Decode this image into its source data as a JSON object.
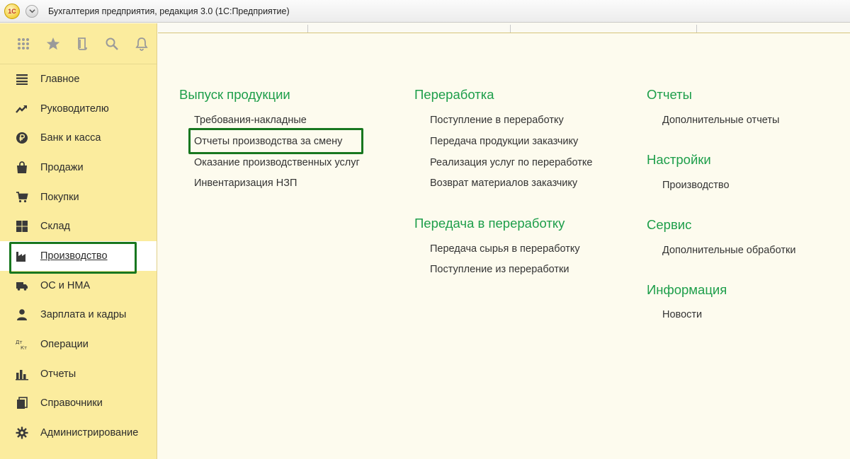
{
  "window": {
    "title": "Бухгалтерия предприятия, редакция 3.0  (1С:Предприятие)",
    "logo_text": "1С"
  },
  "toolbar": {
    "icons": [
      "apps-grid-icon",
      "star-icon",
      "history-icon",
      "search-icon",
      "bell-icon"
    ]
  },
  "sidebar": {
    "active": "Производство",
    "items": [
      {
        "label": "Главное",
        "icon": "menu-lines-icon"
      },
      {
        "label": "Руководителю",
        "icon": "trend-up-icon"
      },
      {
        "label": "Банк и касса",
        "icon": "ruble-coin-icon"
      },
      {
        "label": "Продажи",
        "icon": "shopping-bag-icon"
      },
      {
        "label": "Покупки",
        "icon": "cart-icon"
      },
      {
        "label": "Склад",
        "icon": "warehouse-grid-icon"
      },
      {
        "label": "Производство",
        "icon": "factory-icon"
      },
      {
        "label": "ОС и НМА",
        "icon": "truck-icon"
      },
      {
        "label": "Зарплата и кадры",
        "icon": "person-icon"
      },
      {
        "label": "Операции",
        "icon": "dt-kt-icon"
      },
      {
        "label": "Отчеты",
        "icon": "bar-chart-icon"
      },
      {
        "label": "Справочники",
        "icon": "books-icon"
      },
      {
        "label": "Администрирование",
        "icon": "gear-icon"
      }
    ]
  },
  "sections": {
    "output": {
      "title": "Выпуск продукции",
      "links": [
        "Требования-накладные",
        "Отчеты производства за смену",
        "Оказание производственных услуг",
        "Инвентаризация НЗП"
      ]
    },
    "processing": {
      "title": "Переработка",
      "links": [
        "Поступление в переработку",
        "Передача продукции заказчику",
        "Реализация услуг по переработке",
        "Возврат материалов заказчику"
      ]
    },
    "to_processing": {
      "title": "Передача в переработку",
      "links": [
        "Передача сырья в переработку",
        "Поступление из переработки"
      ]
    },
    "reports": {
      "title": "Отчеты",
      "links": [
        "Дополнительные отчеты"
      ]
    },
    "settings": {
      "title": "Настройки",
      "links": [
        "Производство"
      ]
    },
    "service": {
      "title": "Сервис",
      "links": [
        "Дополнительные обработки"
      ]
    },
    "info": {
      "title": "Информация",
      "links": [
        "Новости"
      ]
    }
  },
  "colors": {
    "sidebar_bg": "#fbec9e",
    "section_title": "#1d9e4a",
    "highlight_border": "#18771f",
    "main_bg": "#fdfbee"
  }
}
